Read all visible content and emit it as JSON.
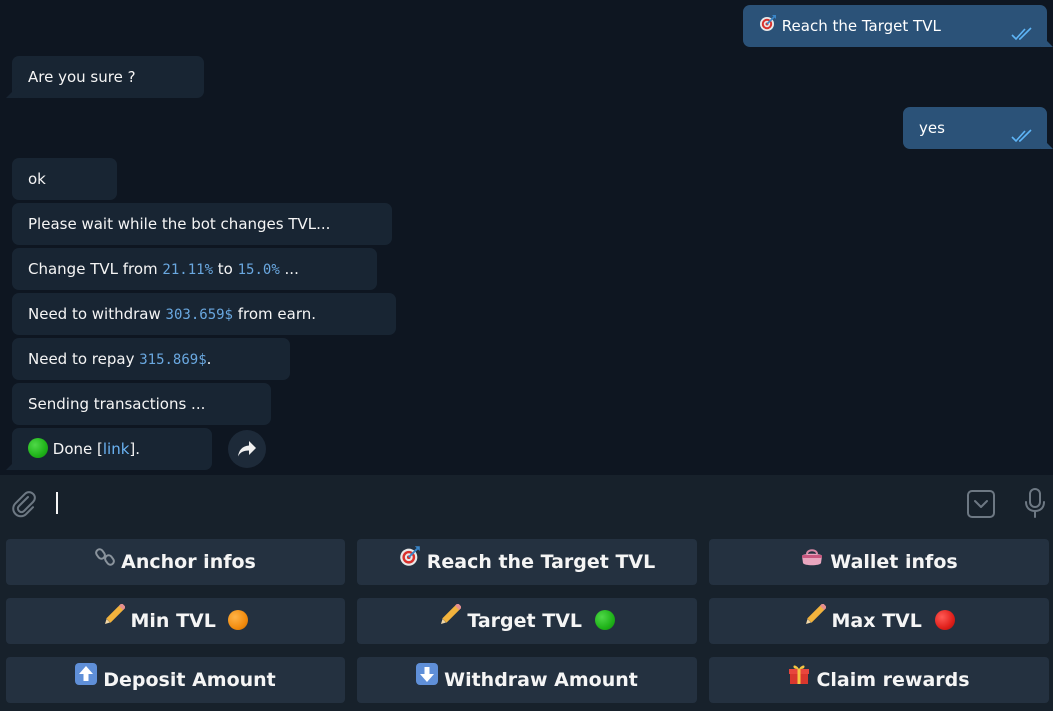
{
  "messages": {
    "m1": {
      "text": "Reach the Target TVL",
      "icon": "target-icon"
    },
    "m2": {
      "text": "Are you sure ?"
    },
    "m3": {
      "text": "yes"
    },
    "m4": {
      "text": "ok"
    },
    "m5": {
      "text": "Please wait while the bot changes TVL..."
    },
    "m6": {
      "pre": "Change TVL from ",
      "v1": "21.11%",
      "mid": " to ",
      "v2": "15.0%",
      "post": " ..."
    },
    "m7": {
      "pre": "Need to withdraw ",
      "v1": "303.659$",
      "post": " from earn."
    },
    "m8": {
      "pre": "Need to repay ",
      "v1": "315.869$",
      "post": "."
    },
    "m9": {
      "text": "Sending transactions ..."
    },
    "m10": {
      "pre": "Done [",
      "link": "link",
      "post": "].",
      "icon": "green-circle-icon"
    }
  },
  "composer": {
    "placeholder": ""
  },
  "keyboard": {
    "row1": [
      "Anchor infos",
      "Reach the Target TVL",
      "Wallet infos"
    ],
    "row2": [
      "Min TVL",
      "Target TVL",
      "Max TVL"
    ],
    "row3": [
      "Deposit Amount",
      "Withdraw Amount",
      "Claim rewards"
    ]
  },
  "colors": {
    "background": "#0e1621",
    "incoming": "#182533",
    "outgoing": "#2b5278",
    "keyboard": "#17212b",
    "button": "#243140",
    "code": "#6aa8e0",
    "green": "#1fb319",
    "orange": "#f28c0f",
    "red": "#e0201b"
  }
}
